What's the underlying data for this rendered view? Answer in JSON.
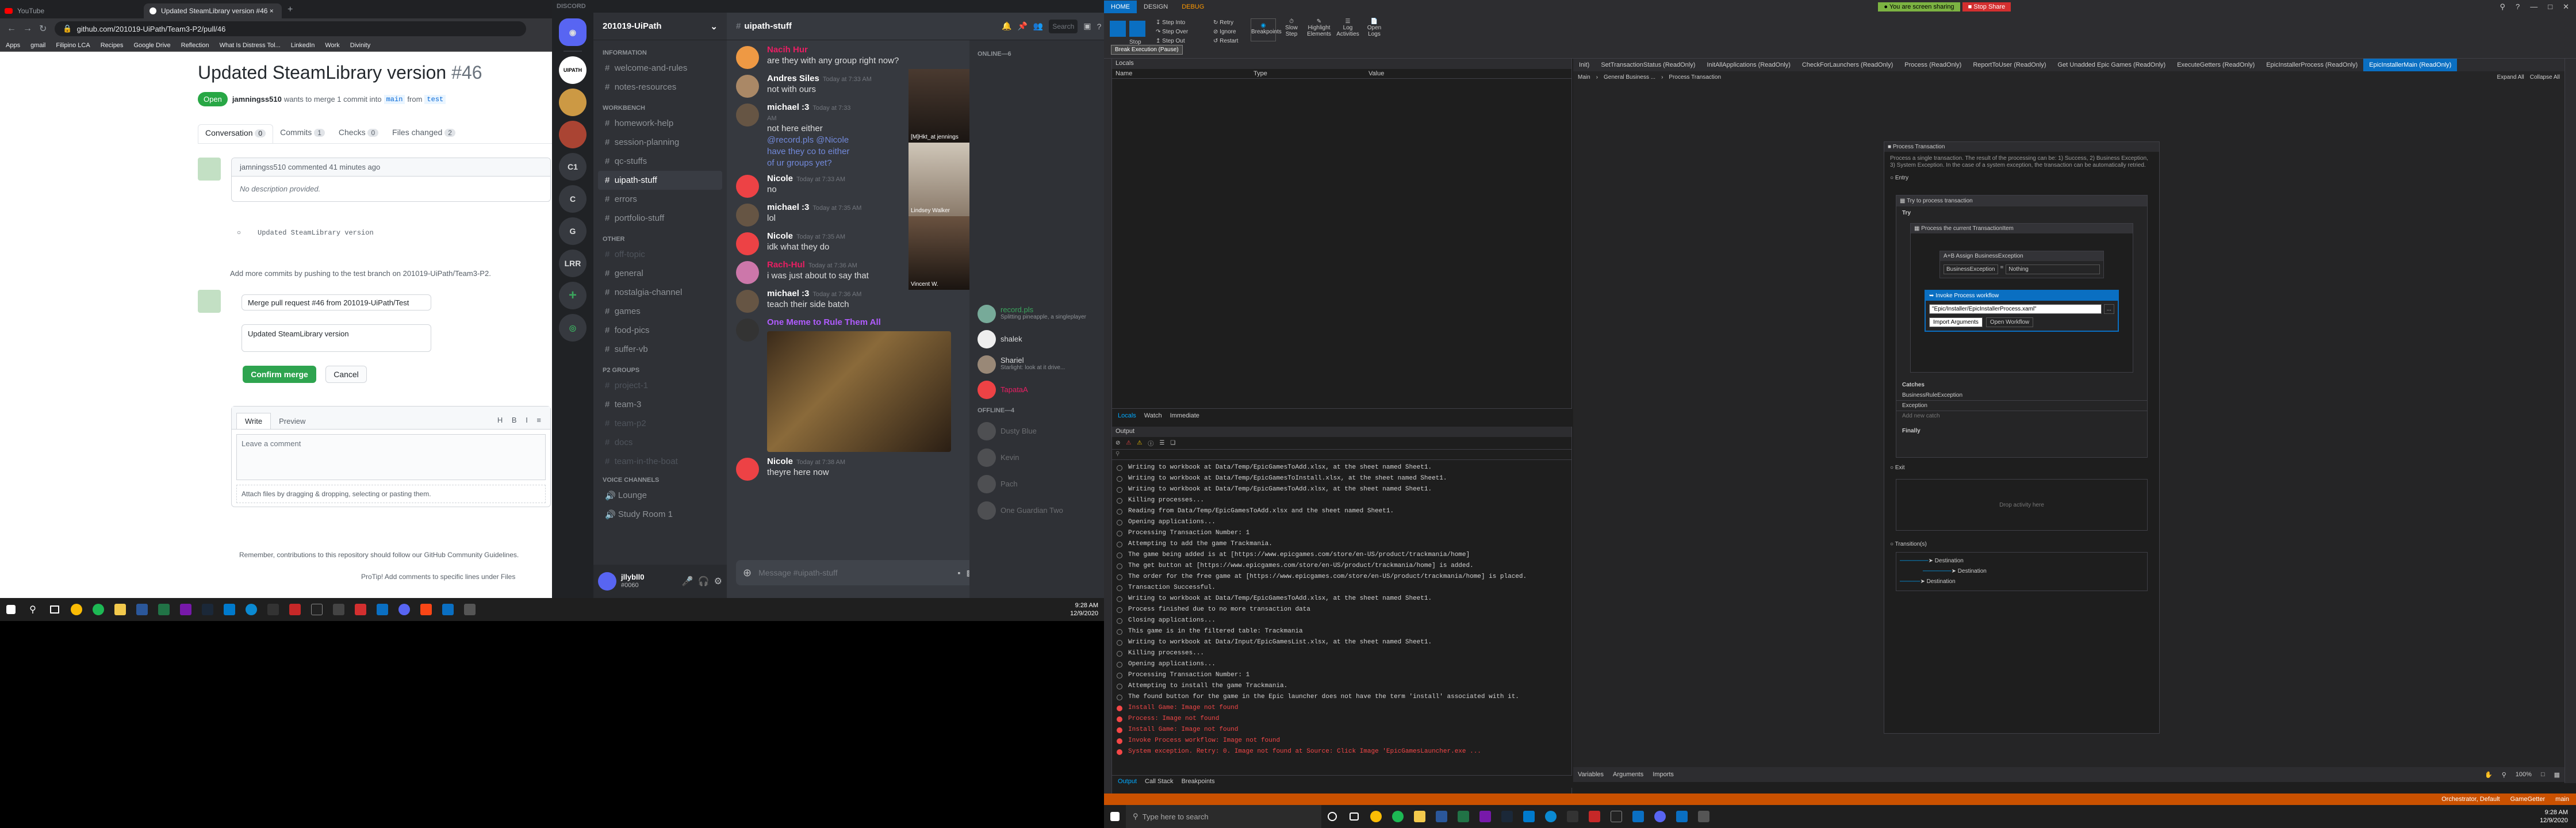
{
  "chrome": {
    "tabs": [
      "YouTube",
      "Updated SteamLibrary version #46 ×"
    ],
    "url": "github.com/201019-UiPath/Team3-P2/pull/46",
    "bookmarks": [
      "Apps",
      "gmail",
      "Filipino LCA",
      "Recipes",
      "Google Drive",
      "Reflection",
      "What Is Distress Tol...",
      "LinkedIn",
      "Work",
      "Divinity"
    ]
  },
  "github": {
    "title": "Updated SteamLibrary version",
    "number": "#46",
    "status": "Open",
    "meta_user": "jamningss510",
    "meta_text": "wants to merge 1 commit into",
    "base": "main",
    "from": "from",
    "head": "test",
    "tabs": [
      {
        "label": "Conversation",
        "count": "0"
      },
      {
        "label": "Commits",
        "count": "1"
      },
      {
        "label": "Checks",
        "count": "0"
      },
      {
        "label": "Files changed",
        "count": "2"
      }
    ],
    "comment_header": "jamningss510 commented 41 minutes ago",
    "no_desc": "No description provided.",
    "commit_msg": "Updated SteamLibrary version",
    "add_more": "Add more commits by pushing to the test branch on 201019-UiPath/Team3-P2.",
    "merge_title": "Merge pull request #46 from 201019-UiPath/Test",
    "merge_body": "Updated SteamLibrary version",
    "confirm_label": "Confirm merge",
    "cancel_label": "Cancel",
    "write_tab": "Write",
    "preview_tab": "Preview",
    "comment_ph": "Leave a comment",
    "attach": "Attach files by dragging & dropping, selecting or pasting them.",
    "remember": "Remember, contributions to this repository should follow our GitHub Community Guidelines.",
    "protip": "ProTip! Add comments to specific lines under Files"
  },
  "discord": {
    "app": "DISCORD",
    "server": "201019-UiPath",
    "servers": [
      "C1",
      "C",
      "G",
      "LRR"
    ],
    "cat_info": "INFORMATION",
    "info_channels": [
      "welcome-and-rules",
      "notes-resources"
    ],
    "cat_workbench": "WORKBENCH",
    "work_channels": [
      "homework-help",
      "session-planning",
      "qc-stuffs",
      "uipath-stuff",
      "errors",
      "portfolio-stuff"
    ],
    "cat_other": "OTHER",
    "other_channels": [
      "off-topic",
      "general",
      "nostalgia-channel",
      "games",
      "food-pics",
      "suffer-vb"
    ],
    "cat_p2": "P2 GROUPS",
    "p2_channels": [
      "project-1",
      "team-3",
      "team-p2",
      "docs",
      "team-in-the-boat"
    ],
    "cat_voice": "VOICE CHANNELS",
    "voice_channels": [
      "Lounge",
      "Study Room 1"
    ],
    "user_name": "jllybll0",
    "user_tag": "#0060",
    "channel": "uipath-stuff",
    "search_ph": "Search",
    "messages": [
      {
        "name": "Nacih Hur",
        "color": "#e91e63",
        "time": "",
        "text": "are they with any group right now?"
      },
      {
        "name": "Andres Siles",
        "color": "#fff",
        "time": "Today at 7:33 AM",
        "text": "not with ours"
      },
      {
        "name": "michael :3",
        "color": "#fff",
        "time": "Today at 7:33 AM",
        "text": "not here either"
      },
      {
        "name": "",
        "color": "",
        "time": "",
        "text": "@record.pls @Nicole have they co to either of ur groups yet?"
      },
      {
        "name": "Nicole",
        "color": "#fff",
        "time": "Today at 7:33 AM",
        "text": "no"
      },
      {
        "name": "michael :3",
        "color": "#fff",
        "time": "Today at 7:35 AM",
        "text": "lol"
      },
      {
        "name": "Nicole",
        "color": "#fff",
        "time": "Today at 7:35 AM",
        "text": "idk what they do"
      },
      {
        "name": "Rach-Hul",
        "color": "#e91e63",
        "time": "Today at 7:36 AM",
        "text": "i was just about to say that"
      },
      {
        "name": "michael :3",
        "color": "#fff",
        "time": "Today at 7:36 AM",
        "text": "teach their side batch"
      },
      {
        "name": "One Meme to Rule Them All",
        "color": "#b05cff",
        "time": "",
        "text": ""
      },
      {
        "name": "Nicole",
        "color": "#fff",
        "time": "Today at 7:38 AM",
        "text": "theyre here now"
      }
    ],
    "msg_ph": "Message #uipath-stuff",
    "video_names": [
      "[M]Hkt_at jennings",
      "Lindsey Walker",
      "Vincent W."
    ],
    "online_header": "ONLINE—6",
    "members": [
      {
        "name": "record.pls",
        "sub": "Splitting pineapple, a singleplayer"
      },
      {
        "name": "shalek",
        "sub": ""
      },
      {
        "name": "Shariel",
        "sub": "Starlight: look at it drive..."
      },
      {
        "name": "TapataA",
        "sub": ""
      }
    ],
    "offline_header": "OFFLINE—4",
    "offline": [
      "Dusty Blue",
      "Kevin",
      "Pach",
      "One Guardian Two"
    ]
  },
  "uipath": {
    "ribbon_tabs": [
      "HOME",
      "DESIGN",
      "DEBUG"
    ],
    "access_banner": "You are screen sharing",
    "stop_share": "Stop Share",
    "ribbon_btns": [
      "Stop",
      "Step Into",
      "Step Over",
      "Step Out",
      "Retry",
      "Ignore",
      "Restart",
      "Breakpoints",
      "Slow Step",
      "Highlight Elements",
      "Log Activities",
      "Open Logs"
    ],
    "focus_label": "Break Execution (Pause)",
    "locals_header": "Locals",
    "locals_cols": [
      "Name",
      "Type",
      "Value"
    ],
    "bottom_tabs": [
      "Locals",
      "Watch",
      "Immediate"
    ],
    "output_header": "Output",
    "output_lines": [
      {
        "t": "Writing to workbook at Data/Temp/EpicGamesToAdd.xlsx, at the sheet named Sheet1.",
        "e": false
      },
      {
        "t": "Writing to workbook at Data/Temp/EpicGamesToInstall.xlsx, at the sheet named Sheet1.",
        "e": false
      },
      {
        "t": "Writing to workbook at Data/Temp/EpicGamesToAdd.xlsx, at the sheet named Sheet1.",
        "e": false
      },
      {
        "t": "Killing processes...",
        "e": false
      },
      {
        "t": "Reading from Data/Temp/EpicGamesToAdd.xlsx and the sheet named Sheet1.",
        "e": false
      },
      {
        "t": "Opening applications...",
        "e": false
      },
      {
        "t": "Processing Transaction Number: 1",
        "e": false
      },
      {
        "t": "Attempting to add the game Trackmania.",
        "e": false
      },
      {
        "t": "The game being added is at [https://www.epicgames.com/store/en-US/product/trackmania/home]",
        "e": false
      },
      {
        "t": "The get button at [https://www.epicgames.com/store/en-US/product/trackmania/home] is added.",
        "e": false
      },
      {
        "t": "The order for the free game at [https://www.epicgames.com/store/en-US/product/trackmania/home] is placed.",
        "e": false
      },
      {
        "t": "Transaction Successful.",
        "e": false
      },
      {
        "t": "Writing to workbook at Data/Temp/EpicGamesToAdd.xlsx, at the sheet named Sheet1.",
        "e": false
      },
      {
        "t": "Process finished due to no more transaction data",
        "e": false
      },
      {
        "t": "Closing applications...",
        "e": false
      },
      {
        "t": "This game is in the filtered table: Trackmania",
        "e": false
      },
      {
        "t": "Writing to workbook at Data/Input/EpicGamesList.xlsx, at the sheet named Sheet1.",
        "e": false
      },
      {
        "t": "Killing processes...",
        "e": false
      },
      {
        "t": "Opening applications...",
        "e": false
      },
      {
        "t": "Processing Transaction Number: 1",
        "e": false
      },
      {
        "t": "Attempting to install the game Trackmania.",
        "e": false
      },
      {
        "t": "The found button for the game in the Epic launcher does not have the term 'install' associated with it.",
        "e": false
      },
      {
        "t": "Install Game: Image not found",
        "e": true
      },
      {
        "t": "Process: Image not found",
        "e": true
      },
      {
        "t": "Install Game: Image not found",
        "e": true
      },
      {
        "t": "Invoke Process workflow: Image not found",
        "e": true
      },
      {
        "t": "System exception. Retry: 0. Image not found at Source: Click Image 'EpicGamesLauncher.exe ...",
        "e": true
      }
    ],
    "output_bottom_tabs": [
      "Output",
      "Call Stack",
      "Breakpoints"
    ],
    "doc_tabs": [
      "Init)",
      "SetTransactionStatus (ReadOnly)",
      "InitAllApplications (ReadOnly)",
      "CheckForLaunchers (ReadOnly)",
      "Process (ReadOnly)",
      "ReportToUser (ReadOnly)",
      "Get Unadded Epic Games (ReadOnly)",
      "ExecuteGetters (ReadOnly)",
      "EpicInstallerProcess (ReadOnly)",
      "EpicInstallerMain (ReadOnly)"
    ],
    "breadcrumb": [
      "Main",
      "General Business ...",
      "Process Transaction"
    ],
    "expand_all": "Expand All",
    "collapse_all": "Collapse All",
    "pt_title": "Process Transaction",
    "pt_desc": "Process a single transaction. The result of the processing can be: 1) Success, 2) Business Exception, 3) System Exception. In the case of a system exception, the transaction can be automatically retried.",
    "entry": "Entry",
    "try_block": "Try to process transaction",
    "try": "Try",
    "process_current": "Process the current TransactionItem",
    "assign": "Assign BusinessException",
    "assign_to": "BusinessException",
    "assign_val": "Nothing",
    "invoke": "Invoke Process workflow",
    "invoke_path": "\"Epic/Installer/EpicInstallerProcess.xaml\"",
    "import_args": "Import Arguments",
    "open_wf": "Open Workflow",
    "catches": "Catches",
    "catch1": "BusinessRuleException",
    "catch2": "Exception",
    "add_catch": "Add new catch",
    "finally": "Finally",
    "exit": "Exit",
    "drop": "Drop activity here",
    "transitions": "Transition(s)",
    "destination": "Destination",
    "bottom_tabs2": [
      "Variables",
      "Arguments",
      "Imports"
    ],
    "zoom": "100%",
    "status_items": [
      "Orchestrator, Default",
      "GameGetter",
      "main"
    ]
  },
  "taskbar": {
    "search_ph": "Type here to search",
    "time1": "9:28 AM",
    "date1": "12/9/2020",
    "time2": "9:28 AM",
    "date2": "12/9/2020"
  }
}
